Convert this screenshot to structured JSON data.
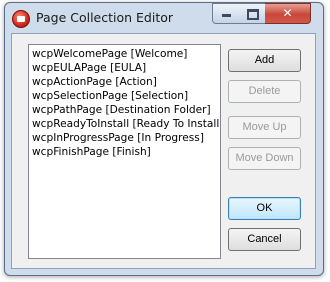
{
  "window": {
    "title": "Page Collection Editor",
    "close_glyph": "✕"
  },
  "pages_list": {
    "items": [
      {
        "label": "wcpWelcomePage [Welcome]"
      },
      {
        "label": "wcpEULAPage [EULA]"
      },
      {
        "label": "wcpActionPage [Action]"
      },
      {
        "label": "wcpSelectionPage [Selection]"
      },
      {
        "label": "wcpPathPage [Destination Folder]"
      },
      {
        "label": "wcpReadyToInstall [Ready To Install]"
      },
      {
        "label": "wcpInProgressPage [In Progress]"
      },
      {
        "label": "wcpFinishPage [Finish]"
      }
    ]
  },
  "buttons": {
    "add": "Add",
    "delete": "Delete",
    "move_up": "Move Up",
    "move_down": "Move Down",
    "ok": "OK",
    "cancel": "Cancel"
  }
}
